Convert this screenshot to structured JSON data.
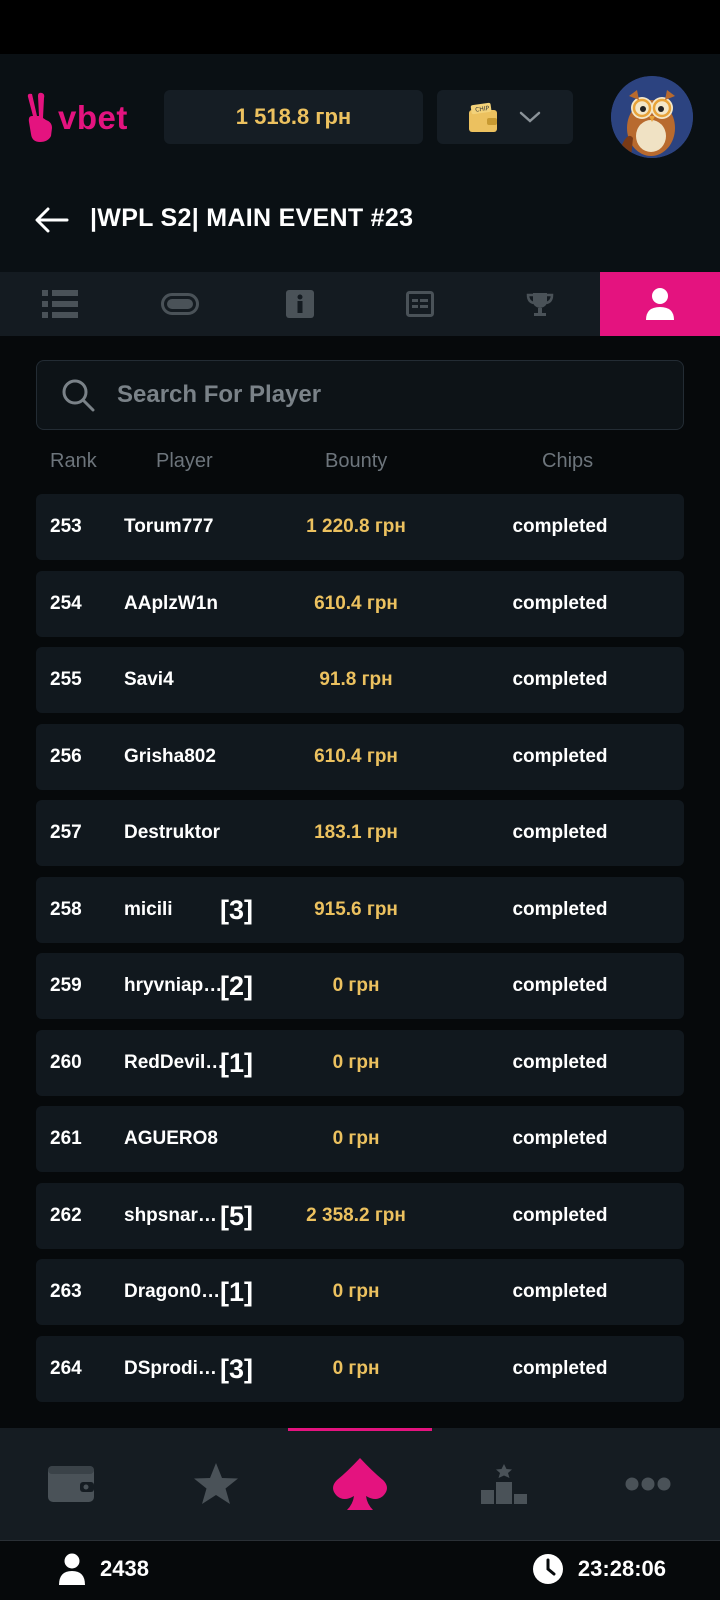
{
  "header": {
    "logo_text": "vbet",
    "balance": "1 518.8 грн"
  },
  "page": {
    "title": "|WPL S2| MAIN EVENT #23"
  },
  "tabs": [
    {
      "icon": "list-icon",
      "active": false
    },
    {
      "icon": "chip-icon",
      "active": false
    },
    {
      "icon": "info-icon",
      "active": false
    },
    {
      "icon": "blinds-icon",
      "active": false
    },
    {
      "icon": "trophy-icon",
      "active": false
    },
    {
      "icon": "player-icon",
      "active": true
    }
  ],
  "search": {
    "placeholder": "Search For Player"
  },
  "table": {
    "headers": [
      "Rank",
      "Player",
      "Bounty",
      "Chips"
    ],
    "rows": [
      {
        "rank": "253",
        "player": "Torum777",
        "badge": "",
        "bounty": "1 220.8 грн",
        "chips": "completed"
      },
      {
        "rank": "254",
        "player": "AAplzW1n",
        "badge": "",
        "bounty": "610.4 грн",
        "chips": "completed"
      },
      {
        "rank": "255",
        "player": "Savi4",
        "badge": "",
        "bounty": "91.8 грн",
        "chips": "completed"
      },
      {
        "rank": "256",
        "player": "Grisha802",
        "badge": "",
        "bounty": "610.4 грн",
        "chips": "completed"
      },
      {
        "rank": "257",
        "player": "Destruktor",
        "badge": "",
        "bounty": "183.1 грн",
        "chips": "completed"
      },
      {
        "rank": "258",
        "player": "micili",
        "badge": "[3]",
        "bounty": "915.6 грн",
        "chips": "completed"
      },
      {
        "rank": "259",
        "player": "hryvniap…",
        "badge": "[2]",
        "bounty": "0 грн",
        "chips": "completed"
      },
      {
        "rank": "260",
        "player": "RedDevil…",
        "badge": "[1]",
        "bounty": "0 грн",
        "chips": "completed"
      },
      {
        "rank": "261",
        "player": "AGUERO8",
        "badge": "",
        "bounty": "0 грн",
        "chips": "completed"
      },
      {
        "rank": "262",
        "player": "shpsnar…",
        "badge": "[5]",
        "bounty": "2 358.2 грн",
        "chips": "completed"
      },
      {
        "rank": "263",
        "player": "Dragon0…",
        "badge": "[1]",
        "bounty": "0 грн",
        "chips": "completed"
      },
      {
        "rank": "264",
        "player": "DSprodi…",
        "badge": "[3]",
        "bounty": "0 грн",
        "chips": "completed"
      }
    ]
  },
  "bottom_nav": [
    {
      "icon": "wallet-icon",
      "active": false
    },
    {
      "icon": "star-icon",
      "active": false
    },
    {
      "icon": "spade-icon",
      "active": true
    },
    {
      "icon": "leaderboard-icon",
      "active": false
    },
    {
      "icon": "more-icon",
      "active": false
    }
  ],
  "footer": {
    "online_count": "2438",
    "time": "23:28:06"
  },
  "colors": {
    "accent": "#e4137f",
    "gold": "#ecc15f",
    "background": "#06090b",
    "row_bg": "#11181e"
  }
}
